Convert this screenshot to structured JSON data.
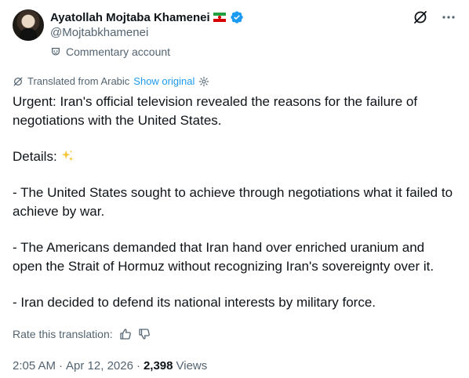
{
  "author": {
    "name": "Ayatollah Mojtaba Khamenei",
    "handle": "@Mojtabkhamenei",
    "account_label": "Commentary account"
  },
  "translation": {
    "note": "Translated from Arabic",
    "show_original": "Show original"
  },
  "tweet": {
    "paragraphs": [
      "Urgent: Iran's official television revealed the reasons for the failure of negotiations with the United States.",
      "Details:",
      "- The United States sought to achieve through negotiations what it failed to achieve by war.",
      "- The Americans demanded that Iran hand over enriched uranium and open the Strait of Hormuz without recognizing Iran's sovereignty over it.",
      "- Iran decided to defend its national interests by military force."
    ]
  },
  "rating": {
    "label": "Rate this translation:"
  },
  "meta": {
    "time": "2:05 AM",
    "separator": "·",
    "date": "Apr 12, 2026",
    "views_count": "2,398",
    "views_label": "Views"
  },
  "colors": {
    "text": "#0f1419",
    "secondary": "#536471",
    "link": "#1d9bf0",
    "verified": "#1d9bf0"
  },
  "icons": [
    "grok-icon",
    "more-icon",
    "verified-icon",
    "flag-iran-icon",
    "commentary-label-icon",
    "translate-icon",
    "settings-icon",
    "sparkles-emoji",
    "thumbs-up-icon",
    "thumbs-down-icon"
  ]
}
